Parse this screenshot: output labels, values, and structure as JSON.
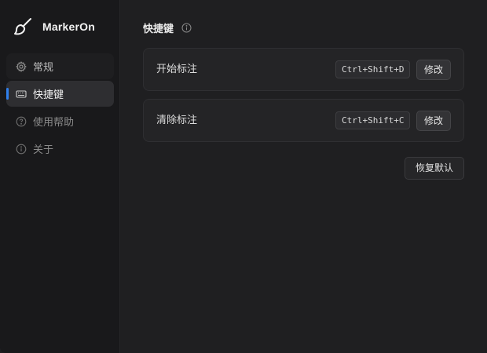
{
  "app": {
    "name": "MarkerOn"
  },
  "sidebar": {
    "items": [
      {
        "label": "常规",
        "icon": "gear-icon"
      },
      {
        "label": "快捷键",
        "icon": "keyboard-icon",
        "active": true
      },
      {
        "label": "使用帮助",
        "icon": "help-circle-icon"
      },
      {
        "label": "关于",
        "icon": "info-circle-icon"
      }
    ]
  },
  "main": {
    "title": "快捷键",
    "shortcuts": [
      {
        "label": "开始标注",
        "keys": "Ctrl+Shift+D",
        "edit_label": "修改"
      },
      {
        "label": "清除标注",
        "keys": "Ctrl+Shift+C",
        "edit_label": "修改"
      }
    ],
    "reset_label": "恢复默认"
  },
  "colors": {
    "accent": "#2f80ed",
    "background": "#1f1f21",
    "sidebar": "#19191b"
  }
}
